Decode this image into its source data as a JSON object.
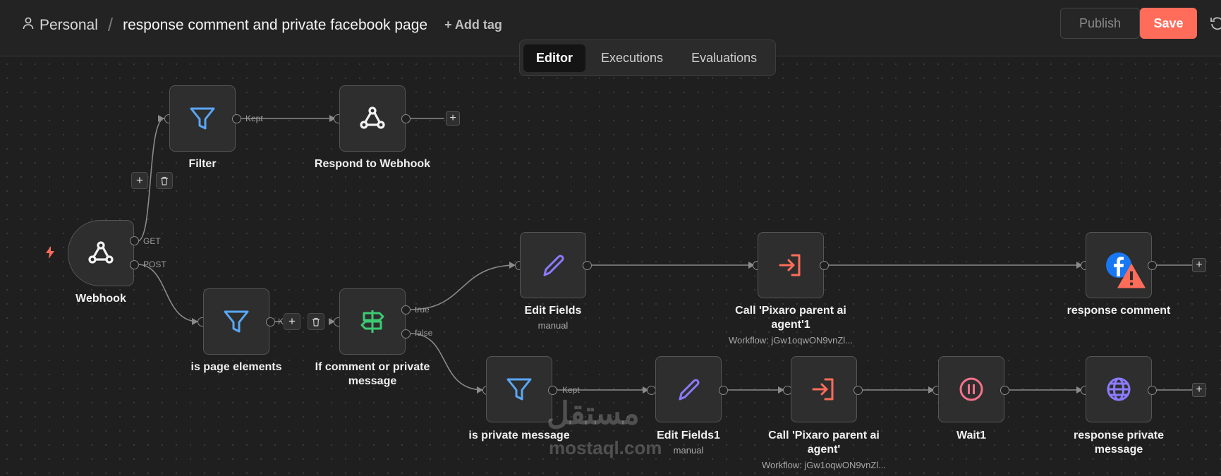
{
  "header": {
    "owner": "Personal",
    "separator": "/",
    "workflow_name": "response comment and private facebook page",
    "add_tag": "+ Add tag",
    "publish": "Publish",
    "save": "Save"
  },
  "tabs": [
    {
      "label": "Editor",
      "active": true
    },
    {
      "label": "Executions",
      "active": false
    },
    {
      "label": "Evaluations",
      "active": false
    }
  ],
  "nodes": {
    "webhook": {
      "label": "Webhook",
      "icon": "webhook-icon"
    },
    "filter": {
      "label": "Filter",
      "icon": "filter-icon"
    },
    "respond": {
      "label": "Respond to Webhook",
      "icon": "webhook-icon"
    },
    "is_page_elements": {
      "label": "is page elements",
      "icon": "filter-icon"
    },
    "if_comment": {
      "label": "If comment or private message",
      "icon": "signpost-icon"
    },
    "edit_fields": {
      "label": "Edit Fields",
      "sub": "manual",
      "icon": "pencil-icon"
    },
    "call_agent1": {
      "label": "Call 'Pixaro parent ai agent'1",
      "sub": "Workflow: jGw1oqwON9vnZl...",
      "icon": "enter-icon"
    },
    "response_comment": {
      "label": "response comment",
      "icon": "facebook-icon"
    },
    "is_private": {
      "label": "is private message",
      "icon": "filter-icon"
    },
    "edit_fields1": {
      "label": "Edit Fields1",
      "sub": "manual",
      "icon": "pencil-icon"
    },
    "call_agent": {
      "label": "Call 'Pixaro parent ai agent'",
      "sub": "Workflow: jGw1oqwON9vnZl...",
      "icon": "enter-icon"
    },
    "wait1": {
      "label": "Wait1",
      "icon": "pause-icon"
    },
    "response_private": {
      "label": "response private message",
      "icon": "globe-icon"
    }
  },
  "edge_labels": {
    "get": "GET",
    "post": "POST",
    "kept": "Kept",
    "kept2": "Kept",
    "true": "true",
    "false": "false",
    "k": "K"
  },
  "watermark": {
    "arabic": "مستقل",
    "latin": "mostaql.com"
  },
  "colors": {
    "accent": "#ff6d5a",
    "filter": "#5aa7f5",
    "signpost": "#3dca73",
    "pencil": "#8c7bff",
    "enter": "#ff6d5a",
    "pause": "#f3728a",
    "globe": "#8c7bff",
    "facebook": "#1877f2"
  }
}
